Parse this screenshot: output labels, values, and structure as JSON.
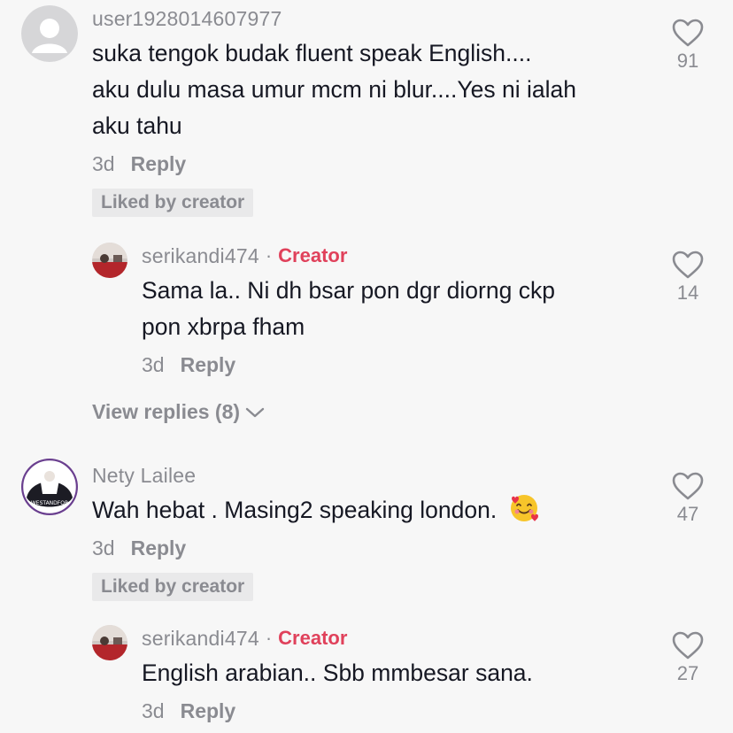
{
  "comments": [
    {
      "username": "user1928014607977",
      "text_lines": [
        "suka tengok budak fluent speak English....",
        "aku dulu masa umur mcm ni blur....Yes ni ialah",
        "aku tahu"
      ],
      "date": "3d",
      "reply_label": "Reply",
      "liked_label": "Liked by creator",
      "like_count": "91",
      "avatar_icon": "default-avatar-icon"
    },
    {
      "username": "serikandi474",
      "separator": "·",
      "badge": "Creator",
      "text_lines": [
        "Sama la.. Ni dh bsar pon dgr diorng ckp",
        "pon xbrpa fham"
      ],
      "date": "3d",
      "reply_label": "Reply",
      "like_count": "14"
    },
    {
      "username": "Nety Lailee",
      "text": "Wah hebat . Masing2 speaking london.",
      "emoji": "smiling-face-with-hearts",
      "date": "3d",
      "reply_label": "Reply",
      "liked_label": "Liked by creator",
      "like_count": "47"
    },
    {
      "username": "serikandi474",
      "separator": "·",
      "badge": "Creator",
      "text": "English arabian.. Sbb mmbesar sana.",
      "date": "3d",
      "reply_label": "Reply",
      "like_count": "27"
    }
  ],
  "view_replies_label": "View replies (8)",
  "colors": {
    "background": "#f7f7f7",
    "text": "#161823",
    "muted": "#8a8b91",
    "creator": "#e0415b",
    "liked_bg": "#e9e9ea"
  }
}
